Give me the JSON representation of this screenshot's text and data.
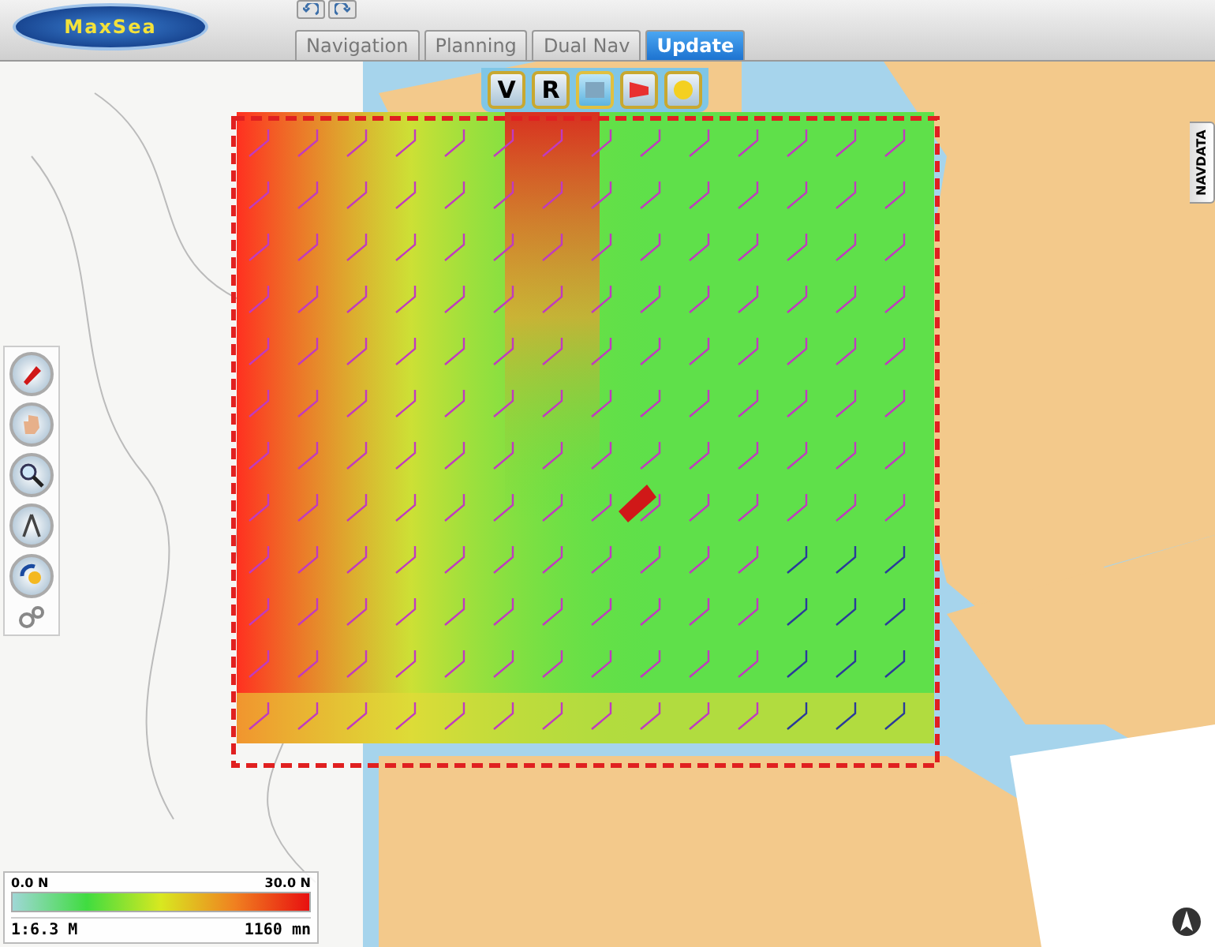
{
  "app": {
    "logo": "MaxSea"
  },
  "tabs": [
    {
      "label": "Navigation",
      "selected": false
    },
    {
      "label": "Planning",
      "selected": false
    },
    {
      "label": "Dual Nav",
      "selected": false
    },
    {
      "label": "Update",
      "selected": true
    }
  ],
  "map_toolbar": [
    {
      "kind": "letter",
      "label": "V",
      "selected": false
    },
    {
      "kind": "letter",
      "label": "R",
      "selected": false
    },
    {
      "kind": "icon",
      "selected": true
    },
    {
      "kind": "icon",
      "selected": false
    },
    {
      "kind": "icon",
      "selected": false
    }
  ],
  "side_panel": {
    "label": "NAVDATA"
  },
  "legend": {
    "min": "0.0 N",
    "max": "30.0 N",
    "scale": "1:6.3 M",
    "distance": "1160 mn"
  }
}
